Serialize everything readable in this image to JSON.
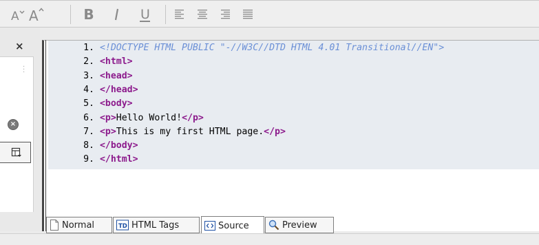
{
  "toolbar": {
    "buttons": [
      {
        "name": "decrease-font-size-button",
        "glyph": "A"
      },
      {
        "name": "increase-font-size-button",
        "glyph": "A"
      },
      {
        "name": "bold-button",
        "glyph": "B"
      },
      {
        "name": "italic-button",
        "glyph": "I"
      },
      {
        "name": "underline-button",
        "glyph": "U"
      }
    ]
  },
  "editor": {
    "lines": [
      {
        "n": "1.",
        "segments": [
          {
            "cls": "doctype",
            "t": "<!DOCTYPE HTML PUBLIC \"-//W3C//DTD HTML 4.01 Transitional//EN\">"
          }
        ]
      },
      {
        "n": "2.",
        "segments": [
          {
            "cls": "tag",
            "t": "<html>"
          }
        ]
      },
      {
        "n": "3.",
        "segments": [
          {
            "cls": "tag",
            "t": "<head>"
          }
        ]
      },
      {
        "n": "4.",
        "segments": [
          {
            "cls": "tag",
            "t": "</head>"
          }
        ]
      },
      {
        "n": "5.",
        "segments": [
          {
            "cls": "tag",
            "t": "<body>"
          }
        ]
      },
      {
        "n": "6.",
        "segments": [
          {
            "cls": "tag",
            "t": "<p>"
          },
          {
            "cls": "txt",
            "t": "Hello World!"
          },
          {
            "cls": "tag",
            "t": "</p>"
          }
        ]
      },
      {
        "n": "7.",
        "segments": [
          {
            "cls": "tag",
            "t": "<p>"
          },
          {
            "cls": "txt",
            "t": "This is my first HTML page."
          },
          {
            "cls": "tag",
            "t": "</p>"
          }
        ]
      },
      {
        "n": "8.",
        "segments": [
          {
            "cls": "tag",
            "t": "</body>"
          }
        ]
      },
      {
        "n": "9.",
        "segments": [
          {
            "cls": "tag",
            "t": "</html>"
          }
        ]
      }
    ]
  },
  "tabs": {
    "normal": "Normal",
    "html_tags": "HTML Tags",
    "html_tags_icon": "TD",
    "source": "Source",
    "preview": "Preview"
  }
}
